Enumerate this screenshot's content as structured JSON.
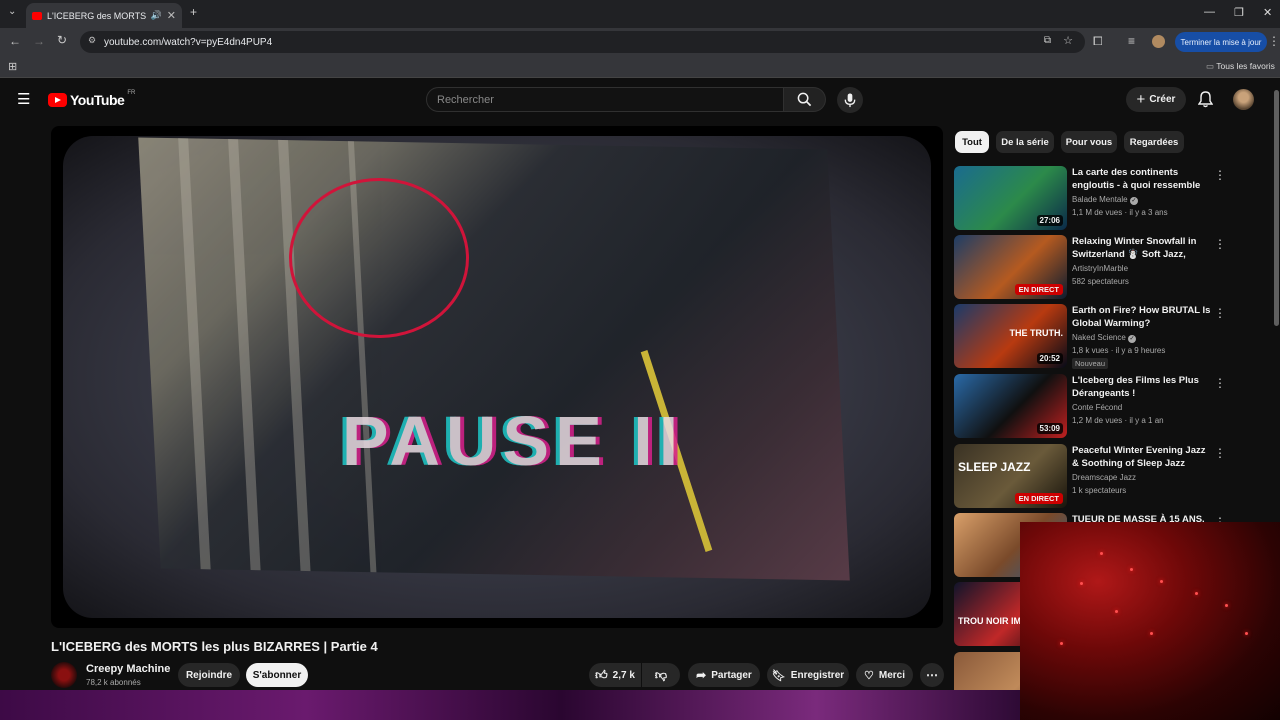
{
  "browser": {
    "tab_title": "L'ICEBERG des MORTS les p",
    "url": "youtube.com/watch?v=pyE4dn4PUP4",
    "update_button": "Terminer la mise à jour",
    "bookmarks_all": "Tous les favoris"
  },
  "header": {
    "logo_text": "YouTube",
    "country_code": "FR",
    "search_placeholder": "Rechercher",
    "create_label": "Créer"
  },
  "video": {
    "overlay_text": "PAUSE II",
    "title": "L'ICEBERG des MORTS les plus BIZARRES | Partie 4",
    "channel": "Creepy Machine",
    "subscribers": "78,2 k abonnés",
    "join_label": "Rejoindre",
    "subscribe_label": "S'abonner",
    "likes": "2,7 k",
    "share_label": "Partager",
    "save_label": "Enregistrer",
    "thanks_label": "Merci"
  },
  "chips": [
    "Tout",
    "De la série",
    "Pour vous",
    "Regardées"
  ],
  "recommendations": [
    {
      "title": "La carte des continents engloutis - à quoi ressemble la...",
      "channel": "Balade Mentale",
      "verified": true,
      "meta": "1,1 M de vues · il y a 3 ans",
      "duration": "27:06",
      "thumb_colors": [
        "#1a6b8f",
        "#2c8a4a",
        "#0b2a4a"
      ]
    },
    {
      "title": "Relaxing Winter Snowfall in Switzerland ☃️ Soft Jazz, Coz...",
      "channel": "ArtistryInMarble",
      "verified": false,
      "meta": "582 spectateurs",
      "live": "EN DIRECT",
      "thumb_colors": [
        "#1d3d66",
        "#b55a20",
        "#0c1c30"
      ]
    },
    {
      "title": "Earth on Fire? How BRUTAL Is Global Warming?",
      "channel": "Naked Science",
      "verified": true,
      "meta": "1,8 k vues · il y a 9 heures",
      "badge": "Nouveau",
      "duration": "20:52",
      "thumb_text": "THE TRUTH.",
      "thumb_colors": [
        "#1a3a6a",
        "#b83a10",
        "#050a18"
      ]
    },
    {
      "title": "L'Iceberg des Films les Plus Dérangeants !",
      "channel": "Conte Fécond",
      "verified": false,
      "meta": "1,2 M de vues · il y a 1 an",
      "duration": "53:09",
      "thumb_colors": [
        "#2a6aa8",
        "#101010",
        "#c02020"
      ]
    },
    {
      "title": "Peaceful Winter Evening Jazz & Soothing of Sleep Jazz Piano ...",
      "channel": "Dreamscape Jazz",
      "verified": false,
      "meta": "1 k spectateurs",
      "live": "EN DIRECT",
      "thumb_text": "SLEEP JAZZ",
      "thumb_colors": [
        "#3a3224",
        "#6a5a3a",
        "#18140c"
      ]
    },
    {
      "title": "TUEUR DE MASSE À 15 ANS,",
      "channel": "",
      "verified": false,
      "meta": "",
      "thumb_colors": [
        "#d9a06a",
        "#7a4a2a",
        "#2a5a8a"
      ]
    },
    {
      "title": "",
      "channel": "",
      "verified": false,
      "meta": "",
      "thumb_text": "TROU NOIR IMMENSE",
      "thumb_colors": [
        "#10142a",
        "#c02828",
        "#05060e"
      ]
    },
    {
      "title": "",
      "channel": "",
      "verified": false,
      "meta": "",
      "thumb_colors": [
        "#8a5a3a",
        "#c08a5a",
        "#3a2010"
      ]
    }
  ]
}
